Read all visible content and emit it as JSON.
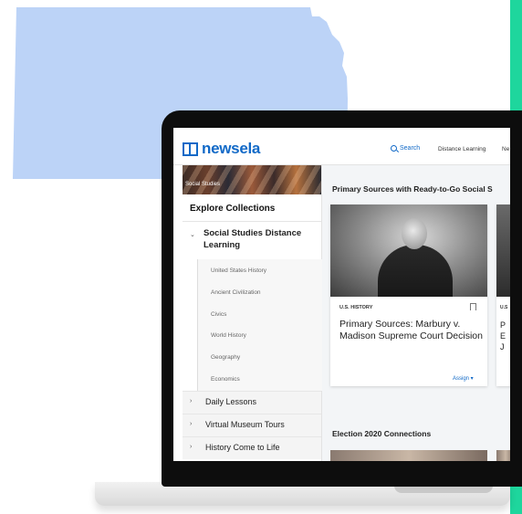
{
  "colors": {
    "accent": "#1169c7",
    "map_fill": "#bcd3f7",
    "green_bar": "#1ed69d"
  },
  "map": {
    "name": "kansas-state-map"
  },
  "app": {
    "logo_text": "newsela"
  },
  "nav": {
    "search": "Search",
    "distance_learning": "Distance Learning",
    "next": "Ne"
  },
  "sidebar": {
    "banner_label": "Social Studies",
    "explore": "Explore Collections",
    "group_title": "Social Studies Distance Learning",
    "sub_items": [
      "United States History",
      "Ancient Civilization",
      "Civics",
      "World History",
      "Geography",
      "Economics"
    ],
    "sections": [
      "Daily Lessons",
      "Virtual Museum Tours",
      "History Come to Life"
    ]
  },
  "main": {
    "section1_title": "Primary Sources with Ready-to-Go Social S",
    "card": {
      "category": "U.S. HISTORY",
      "title": "Primary Sources: Marbury v. Madison Supreme Court Decision",
      "assign": "Assign"
    },
    "card2": {
      "category": "U.S",
      "lines": [
        "P",
        "E",
        "J"
      ]
    },
    "section2_title": "Election 2020 Connections"
  }
}
